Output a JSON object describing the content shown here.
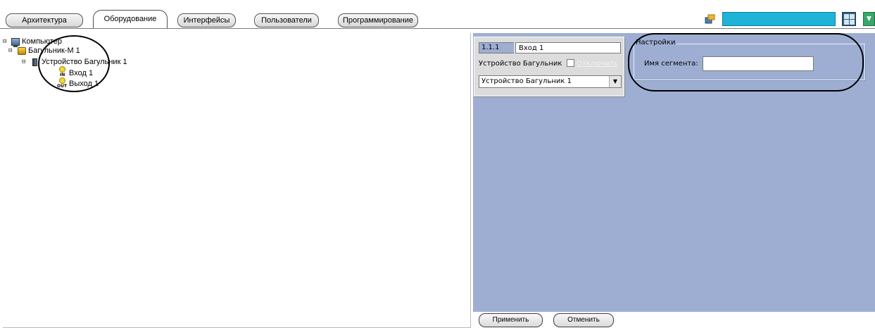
{
  "tabs": [
    {
      "label": "Архитектура"
    },
    {
      "label": "Оборудование"
    },
    {
      "label": "Интерфейсы"
    },
    {
      "label": "Пользователи"
    },
    {
      "label": "Программирование"
    }
  ],
  "tree": {
    "computer": "Компьютер",
    "bagulnik": "Багульник-М 1",
    "device": "Устройство Багульник 1",
    "input": "Вход 1",
    "output": "Выход 1",
    "in_tag": "IN",
    "out_tag": "OUT"
  },
  "props": {
    "code": "1.1.1",
    "name": "Вход 1",
    "device_label": "Устройство Багульник",
    "disable_label": "Отключить",
    "device_selected": "Устройство Багульник 1"
  },
  "settings": {
    "legend": "Настройки",
    "segment_label": "Имя сегмента:",
    "segment_value": ""
  },
  "buttons": {
    "apply": "Применить",
    "cancel": "Отменить"
  },
  "colors": {
    "panel_bg": "#9eaed3",
    "top_field": "#1fb3d8"
  }
}
